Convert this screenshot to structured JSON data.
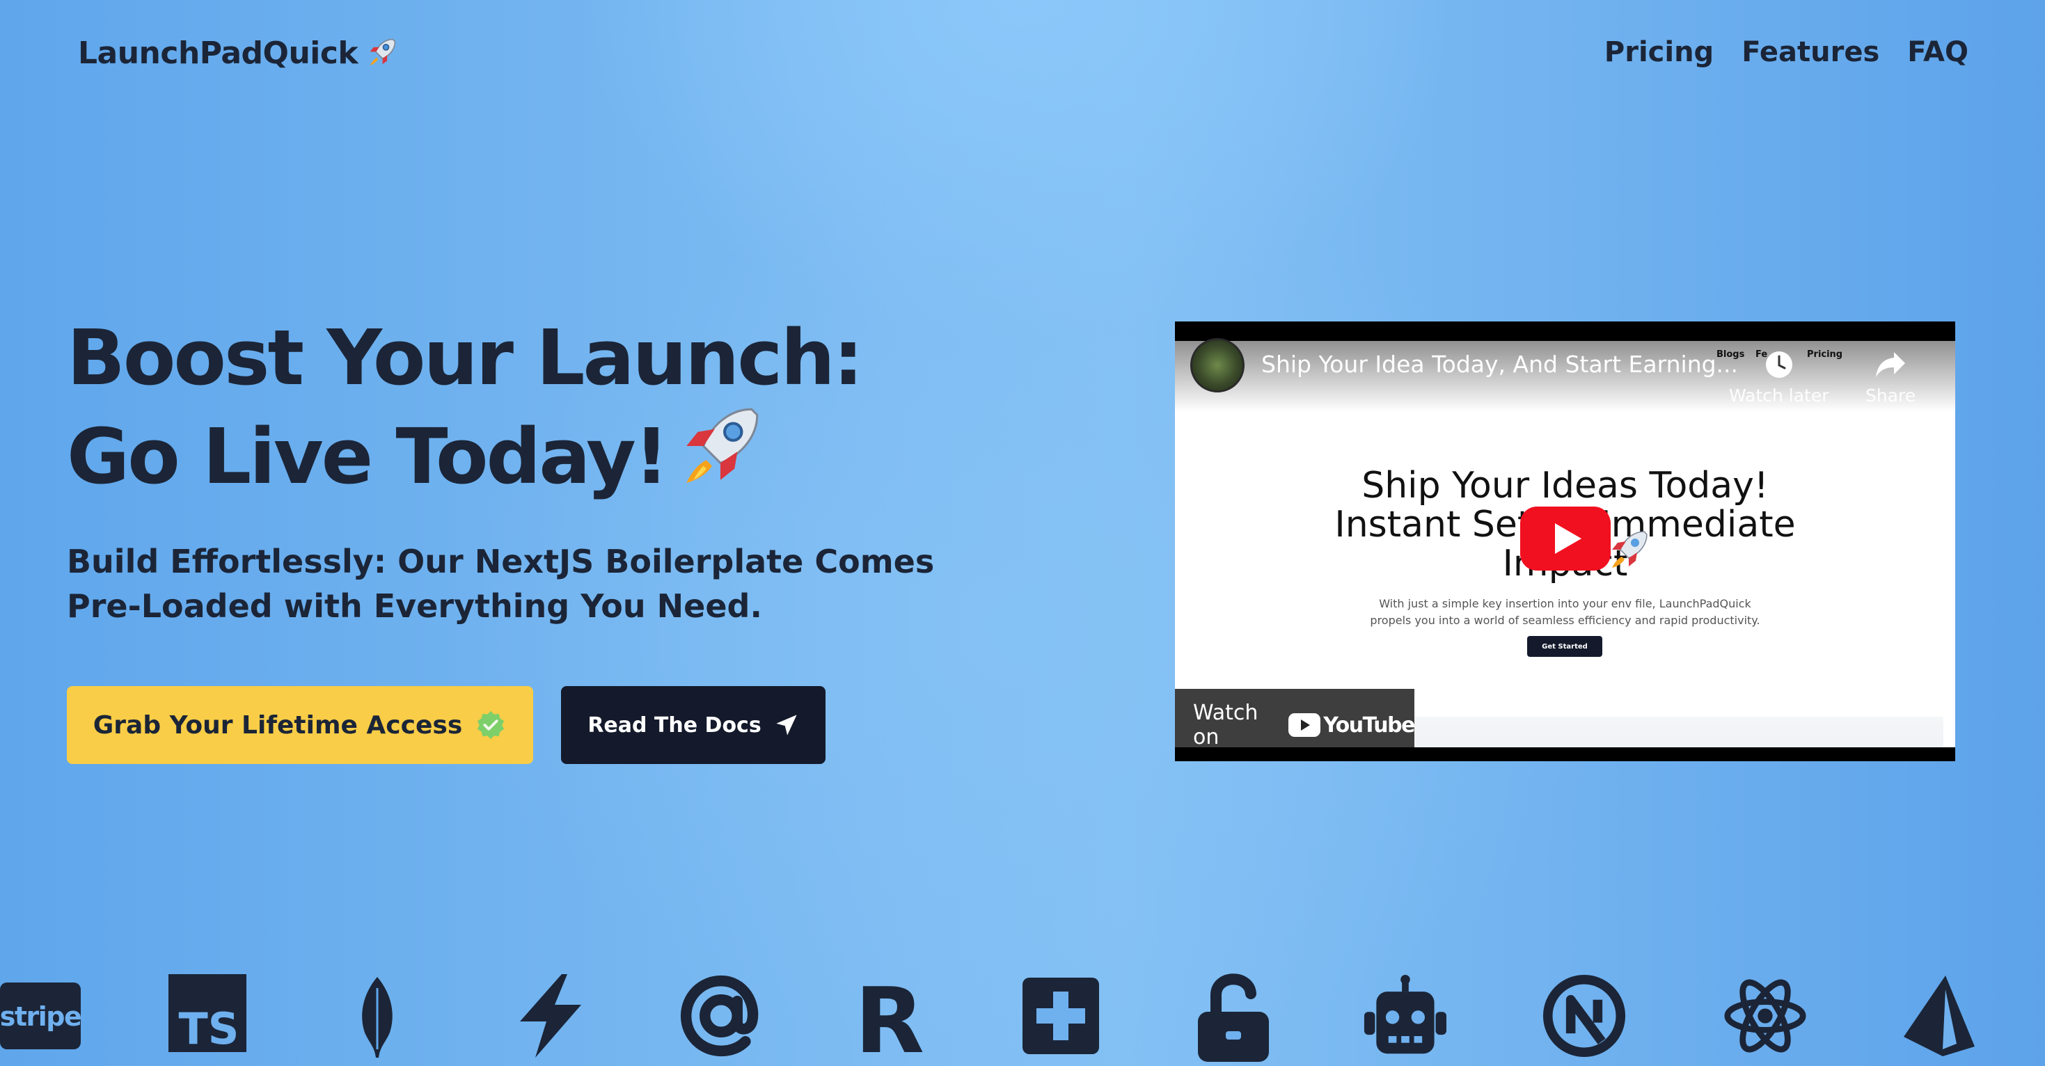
{
  "header": {
    "logo_text": "LaunchPadQuick",
    "logo_icon": "rocket-icon",
    "nav": [
      {
        "label": "Pricing"
      },
      {
        "label": "Features"
      },
      {
        "label": "FAQ"
      }
    ]
  },
  "hero": {
    "title_line1": "Boost Your Launch:",
    "title_line2": "Go Live Today!",
    "subtitle": "Build Effortlessly: Our NextJS Boilerplate Comes Pre-Loaded with Everything You Need.",
    "primary_button": "Grab Your Lifetime Access",
    "primary_icon": "check-badge-icon",
    "secondary_button": "Read The Docs",
    "secondary_icon": "send-arrow-icon"
  },
  "video": {
    "title": "Ship Your Idea Today, And Start Earning...",
    "watch_later": "Watch later",
    "share": "Share",
    "mini_nav": [
      "Blogs",
      "Fe",
      "Pricing"
    ],
    "heading_line1": "Ship Your Ideas Today!",
    "heading_line2": "Instant Setup, Immediate",
    "heading_line3": "Impact",
    "description_line1": "With just a simple key insertion into your env file, LaunchPadQuick",
    "description_line2": "propels you into a world of seamless efficiency and rapid productivity.",
    "cta": "Get Started",
    "watch_on": "Watch on",
    "youtube_wordmark": "YouTube"
  },
  "tech_logos": [
    {
      "name": "stripe-icon",
      "label": "stripe"
    },
    {
      "name": "typescript-icon",
      "label": "TS"
    },
    {
      "name": "mongodb-leaf-icon"
    },
    {
      "name": "lightning-icon"
    },
    {
      "name": "at-sign-icon"
    },
    {
      "name": "resend-icon",
      "label": "R"
    },
    {
      "name": "plus-square-icon"
    },
    {
      "name": "unlock-icon"
    },
    {
      "name": "robot-icon"
    },
    {
      "name": "nextjs-icon"
    },
    {
      "name": "react-icon"
    },
    {
      "name": "prisma-icon"
    }
  ],
  "colors": {
    "primary_button": "#f9cd47",
    "dark": "#141a2b",
    "text": "#1b2537",
    "youtube_red": "#f1101f"
  }
}
